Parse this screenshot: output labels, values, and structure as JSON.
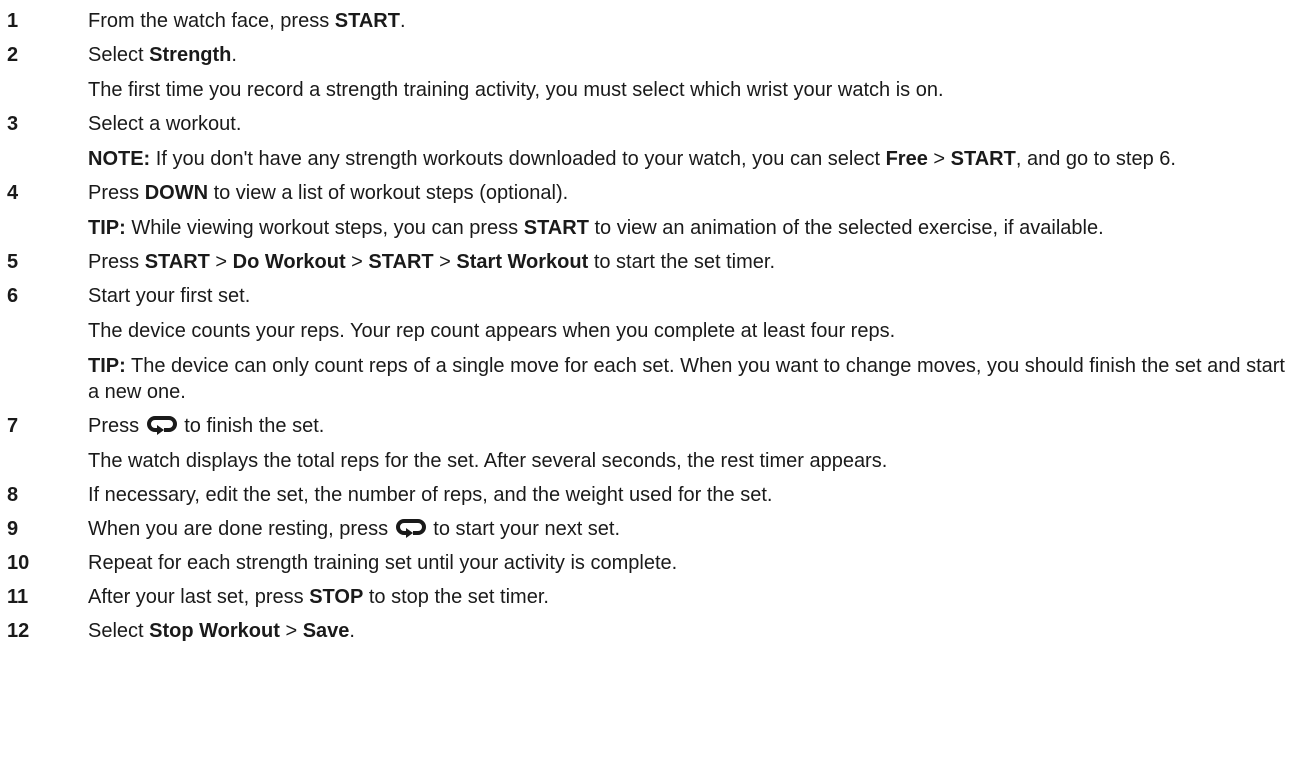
{
  "steps": [
    {
      "num": "1",
      "main": [
        {
          "t": "From the watch face, press "
        },
        {
          "t": "START",
          "b": true
        },
        {
          "t": "."
        }
      ]
    },
    {
      "num": "2",
      "main": [
        {
          "t": "Select "
        },
        {
          "t": "Strength",
          "b": true
        },
        {
          "t": "."
        }
      ],
      "subs": [
        [
          {
            "t": "The first time you record a strength training activity, you must select which wrist your watch is on."
          }
        ]
      ]
    },
    {
      "num": "3",
      "main": [
        {
          "t": "Select a workout."
        }
      ],
      "subs": [
        [
          {
            "t": "NOTE:",
            "b": true
          },
          {
            "t": " If you don't have any strength workouts downloaded to your watch, you can select "
          },
          {
            "t": "Free",
            "b": true
          },
          {
            "t": " > "
          },
          {
            "t": "START",
            "b": true
          },
          {
            "t": ", and go to step 6."
          }
        ]
      ]
    },
    {
      "num": "4",
      "main": [
        {
          "t": "Press "
        },
        {
          "t": "DOWN",
          "b": true
        },
        {
          "t": " to view a list of workout steps (optional)."
        }
      ],
      "subs": [
        [
          {
            "t": "TIP:",
            "b": true
          },
          {
            "t": " While viewing workout steps, you can press "
          },
          {
            "t": "START",
            "b": true
          },
          {
            "t": " to view an animation of the selected exercise, if available."
          }
        ]
      ]
    },
    {
      "num": "5",
      "main": [
        {
          "t": "Press "
        },
        {
          "t": "START",
          "b": true
        },
        {
          "t": " > "
        },
        {
          "t": "Do Workout",
          "b": true
        },
        {
          "t": " > "
        },
        {
          "t": "START",
          "b": true
        },
        {
          "t": " > "
        },
        {
          "t": "Start Workout",
          "b": true
        },
        {
          "t": " to start the set timer."
        }
      ]
    },
    {
      "num": "6",
      "main": [
        {
          "t": "Start your first set."
        }
      ],
      "subs": [
        [
          {
            "t": "The device counts your reps. Your rep count appears when you complete at least four reps."
          }
        ],
        [
          {
            "t": "TIP:",
            "b": true
          },
          {
            "t": " The device can only count reps of a single move for each set. When you want to change moves, you should finish the set and start a new one."
          }
        ]
      ]
    },
    {
      "num": "7",
      "main": [
        {
          "t": "Press "
        },
        {
          "icon": "lap-loop-icon"
        },
        {
          "t": " to finish the set."
        }
      ],
      "subs": [
        [
          {
            "t": "The watch displays the total reps for the set. After several seconds, the rest timer appears."
          }
        ]
      ]
    },
    {
      "num": "8",
      "main": [
        {
          "t": "If necessary, edit the set, the number of reps, and the weight used for the set."
        }
      ]
    },
    {
      "num": "9",
      "main": [
        {
          "t": "When you are done resting, press "
        },
        {
          "icon": "lap-loop-icon"
        },
        {
          "t": " to start your next set."
        }
      ]
    },
    {
      "num": "10",
      "main": [
        {
          "t": "Repeat for each strength training set until your activity is complete."
        }
      ]
    },
    {
      "num": "11",
      "main": [
        {
          "t": "After your last set, press "
        },
        {
          "t": "STOP",
          "b": true
        },
        {
          "t": " to stop the set timer."
        }
      ]
    },
    {
      "num": "12",
      "main": [
        {
          "t": "Select "
        },
        {
          "t": "Stop Workout",
          "b": true
        },
        {
          "t": " > "
        },
        {
          "t": "Save",
          "b": true
        },
        {
          "t": "."
        }
      ]
    }
  ]
}
